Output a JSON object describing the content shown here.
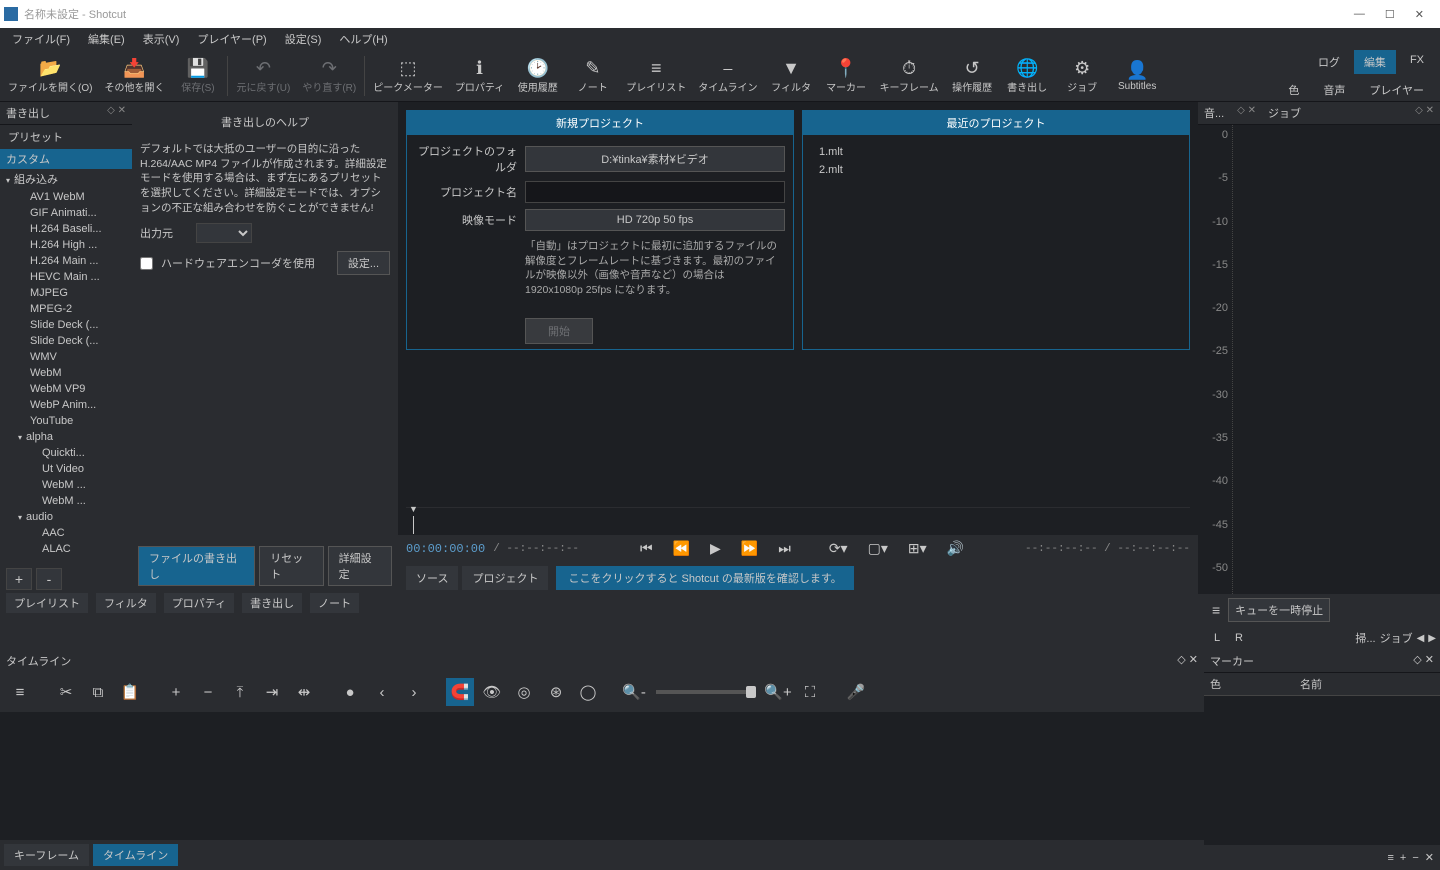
{
  "window": {
    "title": "名称未設定 - Shotcut",
    "min": "—",
    "max": "☐",
    "close": "✕"
  },
  "menu": [
    "ファイル(F)",
    "編集(E)",
    "表示(V)",
    "プレイヤー(P)",
    "設定(S)",
    "ヘルプ(H)"
  ],
  "toolbar": [
    {
      "icon": "📂",
      "label": "ファイルを開く(O)"
    },
    {
      "icon": "📥",
      "label": "その他を開く"
    },
    {
      "icon": "💾",
      "label": "保存(S)",
      "disabled": true
    },
    {
      "icon": "↶",
      "label": "元に戻す(U)",
      "disabled": true
    },
    {
      "icon": "↷",
      "label": "やり直す(R)",
      "disabled": true
    },
    {
      "icon": "sep"
    },
    {
      "icon": "📊",
      "label": "ピークメーター"
    },
    {
      "icon": "ℹ",
      "label": "プロパティ"
    },
    {
      "icon": "🕐",
      "label": "使用履歴"
    },
    {
      "icon": "✎",
      "label": "ノート"
    },
    {
      "icon": "≡",
      "label": "プレイリスト"
    },
    {
      "icon": "⎯",
      "label": "タイムライン"
    },
    {
      "icon": "⏷",
      "label": "フィルタ"
    },
    {
      "icon": "📍",
      "label": "マーカー"
    },
    {
      "icon": "⏱",
      "label": "キーフレーム"
    },
    {
      "icon": "↺",
      "label": "操作履歴"
    },
    {
      "icon": "🌐",
      "label": "書き出し"
    },
    {
      "icon": "⚙",
      "label": "ジョブ"
    },
    {
      "icon": "👤",
      "label": "Subtitles"
    }
  ],
  "rightTabs": {
    "row1": [
      "ログ",
      "編集",
      "FX"
    ],
    "row2": [
      "色",
      "音声",
      "プレイヤー"
    ],
    "active": "編集"
  },
  "export": {
    "title": "書き出し",
    "presetsLabel": "プリセット",
    "groups": {
      "custom": "カスタム",
      "builtin": "組み込み",
      "alpha": "alpha",
      "audio": "audio"
    },
    "builtinItems": [
      "AV1 WebM",
      "GIF Animati...",
      "H.264 Baseli...",
      "H.264 High ...",
      "H.264 Main ...",
      "HEVC Main ...",
      "MJPEG",
      "MPEG-2",
      "Slide Deck (...",
      "Slide Deck (...",
      "WMV",
      "WebM",
      "WebM VP9",
      "WebP Anim...",
      "YouTube"
    ],
    "alphaItems": [
      "Quickti...",
      "Ut Video",
      "WebM ...",
      "WebM ..."
    ],
    "audioItems": [
      "AAC",
      "ALAC"
    ],
    "exportFile": "ファイルの書き出し",
    "reset": "リセット",
    "advanced": "詳細設定",
    "plus": "+",
    "minus": "-"
  },
  "help": {
    "title": "書き出しのヘルプ",
    "text": "デフォルトでは大抵のユーザーの目的に沿った H.264/AAC MP4 ファイルが作成されます。詳細設定モードを使用する場合は、まず左にあるプリセットを選択してください。詳細設定モードでは、オプションの不正な組み合わせを防ぐことができません!",
    "outputLabel": "出力元",
    "hwenc": "ハードウェアエンコーダを使用",
    "configure": "設定..."
  },
  "newProject": {
    "title": "新規プロジェクト",
    "folderLabel": "プロジェクトのフォルダ",
    "folder": "D:¥tinka¥素材¥ビデオ",
    "nameLabel": "プロジェクト名",
    "name": "",
    "modeLabel": "映像モード",
    "mode": "HD 720p 50 fps",
    "note": "「自動」はプロジェクトに最初に追加するファイルの解像度とフレームレートに基づきます。最初のファイルが映像以外（画像や音声など）の場合は 1920x1080p 25fps になります。",
    "start": "開始"
  },
  "recent": {
    "title": "最近のプロジェクト",
    "items": [
      "1.mlt",
      "2.mlt"
    ]
  },
  "meter": {
    "title": "音...",
    "scale": [
      "0",
      "-5",
      "-10",
      "-15",
      "-20",
      "-25",
      "-30",
      "-35",
      "-40",
      "-45",
      "-50"
    ],
    "L": "L",
    "R": "R"
  },
  "jobs": {
    "title": "ジョブ",
    "pause": "キューを一時停止",
    "drop": "掃...",
    "jobbtn": "ジョブ"
  },
  "transport": {
    "time": "00:00:00:00",
    "dur1": "/ --:--:--:--",
    "dur2": "--:--:--:-- / --:--:--:--",
    "source": "ソース",
    "project": "プロジェクト",
    "update": "ここをクリックすると Shotcut の最新版を確認します。"
  },
  "bottomTabs": [
    "プレイリスト",
    "フィルタ",
    "プロパティ",
    "書き出し",
    "ノート"
  ],
  "timeline": {
    "title": "タイムライン",
    "tabs": [
      "キーフレーム",
      "タイムライン"
    ],
    "active": "タイムライン"
  },
  "markers": {
    "title": "マーカー",
    "col1": "色",
    "col2": "名前"
  }
}
